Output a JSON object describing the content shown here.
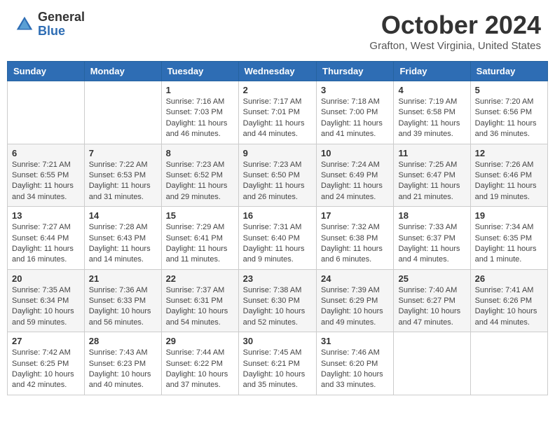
{
  "header": {
    "logo": {
      "line1": "General",
      "line2": "Blue"
    },
    "month_title": "October 2024",
    "location": "Grafton, West Virginia, United States"
  },
  "weekdays": [
    "Sunday",
    "Monday",
    "Tuesday",
    "Wednesday",
    "Thursday",
    "Friday",
    "Saturday"
  ],
  "weeks": [
    [
      null,
      null,
      {
        "day": "1",
        "sunrise": "Sunrise: 7:16 AM",
        "sunset": "Sunset: 7:03 PM",
        "daylight": "Daylight: 11 hours and 46 minutes."
      },
      {
        "day": "2",
        "sunrise": "Sunrise: 7:17 AM",
        "sunset": "Sunset: 7:01 PM",
        "daylight": "Daylight: 11 hours and 44 minutes."
      },
      {
        "day": "3",
        "sunrise": "Sunrise: 7:18 AM",
        "sunset": "Sunset: 7:00 PM",
        "daylight": "Daylight: 11 hours and 41 minutes."
      },
      {
        "day": "4",
        "sunrise": "Sunrise: 7:19 AM",
        "sunset": "Sunset: 6:58 PM",
        "daylight": "Daylight: 11 hours and 39 minutes."
      },
      {
        "day": "5",
        "sunrise": "Sunrise: 7:20 AM",
        "sunset": "Sunset: 6:56 PM",
        "daylight": "Daylight: 11 hours and 36 minutes."
      }
    ],
    [
      {
        "day": "6",
        "sunrise": "Sunrise: 7:21 AM",
        "sunset": "Sunset: 6:55 PM",
        "daylight": "Daylight: 11 hours and 34 minutes."
      },
      {
        "day": "7",
        "sunrise": "Sunrise: 7:22 AM",
        "sunset": "Sunset: 6:53 PM",
        "daylight": "Daylight: 11 hours and 31 minutes."
      },
      {
        "day": "8",
        "sunrise": "Sunrise: 7:23 AM",
        "sunset": "Sunset: 6:52 PM",
        "daylight": "Daylight: 11 hours and 29 minutes."
      },
      {
        "day": "9",
        "sunrise": "Sunrise: 7:23 AM",
        "sunset": "Sunset: 6:50 PM",
        "daylight": "Daylight: 11 hours and 26 minutes."
      },
      {
        "day": "10",
        "sunrise": "Sunrise: 7:24 AM",
        "sunset": "Sunset: 6:49 PM",
        "daylight": "Daylight: 11 hours and 24 minutes."
      },
      {
        "day": "11",
        "sunrise": "Sunrise: 7:25 AM",
        "sunset": "Sunset: 6:47 PM",
        "daylight": "Daylight: 11 hours and 21 minutes."
      },
      {
        "day": "12",
        "sunrise": "Sunrise: 7:26 AM",
        "sunset": "Sunset: 6:46 PM",
        "daylight": "Daylight: 11 hours and 19 minutes."
      }
    ],
    [
      {
        "day": "13",
        "sunrise": "Sunrise: 7:27 AM",
        "sunset": "Sunset: 6:44 PM",
        "daylight": "Daylight: 11 hours and 16 minutes."
      },
      {
        "day": "14",
        "sunrise": "Sunrise: 7:28 AM",
        "sunset": "Sunset: 6:43 PM",
        "daylight": "Daylight: 11 hours and 14 minutes."
      },
      {
        "day": "15",
        "sunrise": "Sunrise: 7:29 AM",
        "sunset": "Sunset: 6:41 PM",
        "daylight": "Daylight: 11 hours and 11 minutes."
      },
      {
        "day": "16",
        "sunrise": "Sunrise: 7:31 AM",
        "sunset": "Sunset: 6:40 PM",
        "daylight": "Daylight: 11 hours and 9 minutes."
      },
      {
        "day": "17",
        "sunrise": "Sunrise: 7:32 AM",
        "sunset": "Sunset: 6:38 PM",
        "daylight": "Daylight: 11 hours and 6 minutes."
      },
      {
        "day": "18",
        "sunrise": "Sunrise: 7:33 AM",
        "sunset": "Sunset: 6:37 PM",
        "daylight": "Daylight: 11 hours and 4 minutes."
      },
      {
        "day": "19",
        "sunrise": "Sunrise: 7:34 AM",
        "sunset": "Sunset: 6:35 PM",
        "daylight": "Daylight: 11 hours and 1 minute."
      }
    ],
    [
      {
        "day": "20",
        "sunrise": "Sunrise: 7:35 AM",
        "sunset": "Sunset: 6:34 PM",
        "daylight": "Daylight: 10 hours and 59 minutes."
      },
      {
        "day": "21",
        "sunrise": "Sunrise: 7:36 AM",
        "sunset": "Sunset: 6:33 PM",
        "daylight": "Daylight: 10 hours and 56 minutes."
      },
      {
        "day": "22",
        "sunrise": "Sunrise: 7:37 AM",
        "sunset": "Sunset: 6:31 PM",
        "daylight": "Daylight: 10 hours and 54 minutes."
      },
      {
        "day": "23",
        "sunrise": "Sunrise: 7:38 AM",
        "sunset": "Sunset: 6:30 PM",
        "daylight": "Daylight: 10 hours and 52 minutes."
      },
      {
        "day": "24",
        "sunrise": "Sunrise: 7:39 AM",
        "sunset": "Sunset: 6:29 PM",
        "daylight": "Daylight: 10 hours and 49 minutes."
      },
      {
        "day": "25",
        "sunrise": "Sunrise: 7:40 AM",
        "sunset": "Sunset: 6:27 PM",
        "daylight": "Daylight: 10 hours and 47 minutes."
      },
      {
        "day": "26",
        "sunrise": "Sunrise: 7:41 AM",
        "sunset": "Sunset: 6:26 PM",
        "daylight": "Daylight: 10 hours and 44 minutes."
      }
    ],
    [
      {
        "day": "27",
        "sunrise": "Sunrise: 7:42 AM",
        "sunset": "Sunset: 6:25 PM",
        "daylight": "Daylight: 10 hours and 42 minutes."
      },
      {
        "day": "28",
        "sunrise": "Sunrise: 7:43 AM",
        "sunset": "Sunset: 6:23 PM",
        "daylight": "Daylight: 10 hours and 40 minutes."
      },
      {
        "day": "29",
        "sunrise": "Sunrise: 7:44 AM",
        "sunset": "Sunset: 6:22 PM",
        "daylight": "Daylight: 10 hours and 37 minutes."
      },
      {
        "day": "30",
        "sunrise": "Sunrise: 7:45 AM",
        "sunset": "Sunset: 6:21 PM",
        "daylight": "Daylight: 10 hours and 35 minutes."
      },
      {
        "day": "31",
        "sunrise": "Sunrise: 7:46 AM",
        "sunset": "Sunset: 6:20 PM",
        "daylight": "Daylight: 10 hours and 33 minutes."
      },
      null,
      null
    ]
  ]
}
